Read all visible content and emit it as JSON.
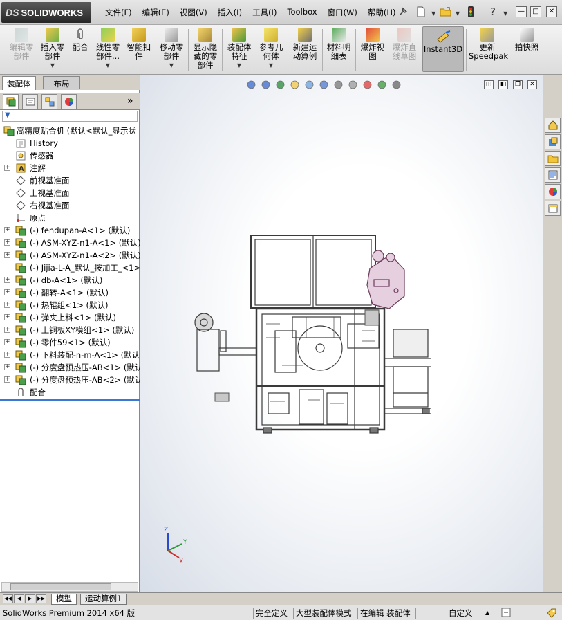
{
  "app": {
    "logo_mark": "DS",
    "logo_text": "SOLIDWORKS"
  },
  "menu": [
    "文件(F)",
    "编辑(E)",
    "视图(V)",
    "插入(I)",
    "工具(I)",
    "Toolbox",
    "窗口(W)",
    "帮助(H)"
  ],
  "toolbar_icons": [
    "pin-icon",
    "new-document-icon",
    "open-folder-icon",
    "traffic-light-icon",
    "help-icon"
  ],
  "window_controls": {
    "minimize": "—",
    "restore": "□",
    "close": "✕"
  },
  "commands": [
    {
      "label": "编辑零\n部件",
      "enabled": false,
      "dropdown": false
    },
    {
      "label": "插入零\n部件",
      "enabled": true,
      "dropdown": true
    },
    {
      "label": "配合",
      "enabled": true,
      "dropdown": false
    },
    {
      "label": "线性零\n部件...",
      "enabled": true,
      "dropdown": true
    },
    {
      "label": "智能扣\n件",
      "enabled": true,
      "dropdown": false
    },
    {
      "label": "移动零\n部件",
      "enabled": true,
      "dropdown": true
    },
    {
      "label": "显示隐\n藏的零\n部件",
      "enabled": true,
      "dropdown": false
    },
    {
      "label": "装配体\n特征",
      "enabled": true,
      "dropdown": true
    },
    {
      "label": "参考几\n何体",
      "enabled": true,
      "dropdown": true
    },
    {
      "label": "新建运\n动算例",
      "enabled": true,
      "dropdown": false
    },
    {
      "label": "材料明\n细表",
      "enabled": true,
      "dropdown": false
    },
    {
      "label": "爆炸视\n图",
      "enabled": true,
      "dropdown": false
    },
    {
      "label": "爆炸直\n线草图",
      "enabled": false,
      "dropdown": false
    },
    {
      "label": "Instant3D",
      "enabled": true,
      "dropdown": false,
      "active": true
    },
    {
      "label": "更新\nSpeedpak",
      "enabled": true,
      "dropdown": false
    },
    {
      "label": "拍快照",
      "enabled": true,
      "dropdown": false
    }
  ],
  "pane_tabs": [
    {
      "label": "装配体",
      "active": true
    },
    {
      "label": "布局",
      "active": false
    }
  ],
  "manager_tabs": [
    "featuremanager-icon",
    "propertymanager-icon",
    "configurationmanager-icon",
    "displaymanager-icon"
  ],
  "manager_more": "»",
  "filter_icon": "filter-icon",
  "tree": [
    {
      "label": "高精度贴合机 (默认<默认_显示状",
      "icon": "assembly",
      "expand": false,
      "root": true
    },
    {
      "label": "History",
      "icon": "history",
      "expand": false
    },
    {
      "label": "传感器",
      "icon": "sensor",
      "expand": false
    },
    {
      "label": "注解",
      "icon": "annotation",
      "expand": true
    },
    {
      "label": "前视基准面",
      "icon": "plane",
      "expand": false
    },
    {
      "label": "上视基准面",
      "icon": "plane",
      "expand": false
    },
    {
      "label": "右视基准面",
      "icon": "plane",
      "expand": false
    },
    {
      "label": "原点",
      "icon": "origin",
      "expand": false
    },
    {
      "label": "(-) fendupan-A<1> (默认)",
      "icon": "subassembly",
      "expand": true
    },
    {
      "label": "(-) ASM-XYZ-n1-A<1> (默认)",
      "icon": "subassembly",
      "expand": true
    },
    {
      "label": "(-) ASM-XYZ-n1-A<2> (默认)",
      "icon": "subassembly",
      "expand": true
    },
    {
      "label": "(-) Jijia-L-A_默认_按加工_<1>",
      "icon": "subassembly",
      "expand": false
    },
    {
      "label": "(-) db-A<1> (默认)",
      "icon": "subassembly",
      "expand": true
    },
    {
      "label": "(-) 翻转-A<1> (默认)",
      "icon": "subassembly",
      "expand": true
    },
    {
      "label": "(-) 热辊组<1> (默认)",
      "icon": "subassembly",
      "expand": true
    },
    {
      "label": "(-) 弹夹上料<1> (默认)",
      "icon": "subassembly",
      "expand": true
    },
    {
      "label": "(-) 上铜板XY模组<1> (默认)",
      "icon": "subassembly",
      "expand": true
    },
    {
      "label": "(-) 零件59<1> (默认)",
      "icon": "subassembly",
      "expand": true
    },
    {
      "label": "(-) 下料装配-n-m-A<1> (默认)",
      "icon": "subassembly",
      "expand": true
    },
    {
      "label": "(-) 分度盘预热压-AB<1> (默认",
      "icon": "subassembly",
      "expand": true
    },
    {
      "label": "(-) 分度盘预热压-AB<2> (默认",
      "icon": "subassembly",
      "expand": true
    },
    {
      "label": "配合",
      "icon": "mates",
      "expand": false
    }
  ],
  "heads_up_icons": [
    "zoom-to-fit-icon",
    "zoom-to-area-icon",
    "previous-view-icon",
    "section-view-icon",
    "dynamic-annotation-icon",
    "view-orientation-icon",
    "display-style-icon",
    "hide-show-icon",
    "edit-appearance-icon",
    "apply-scene-icon",
    "view-settings-icon"
  ],
  "viewport_controls": [
    "◫",
    "◧",
    "❐",
    "✕"
  ],
  "triad": {
    "x": "X",
    "y": "Y",
    "z": "Z"
  },
  "task_pane_icons": [
    "solidworks-resources-icon",
    "design-library-icon",
    "file-explorer-icon",
    "view-palette-icon",
    "appearances-scenes-icon",
    "custom-properties-icon"
  ],
  "bottom_tabs": [
    {
      "label": "模型",
      "active": true
    },
    {
      "label": "运动算例1",
      "active": false
    }
  ],
  "status": {
    "product": "SolidWorks Premium 2014 x64 版",
    "definition": "完全定义",
    "mode": "大型装配体模式",
    "editing": "在编辑 装配体",
    "units": "自定义"
  }
}
